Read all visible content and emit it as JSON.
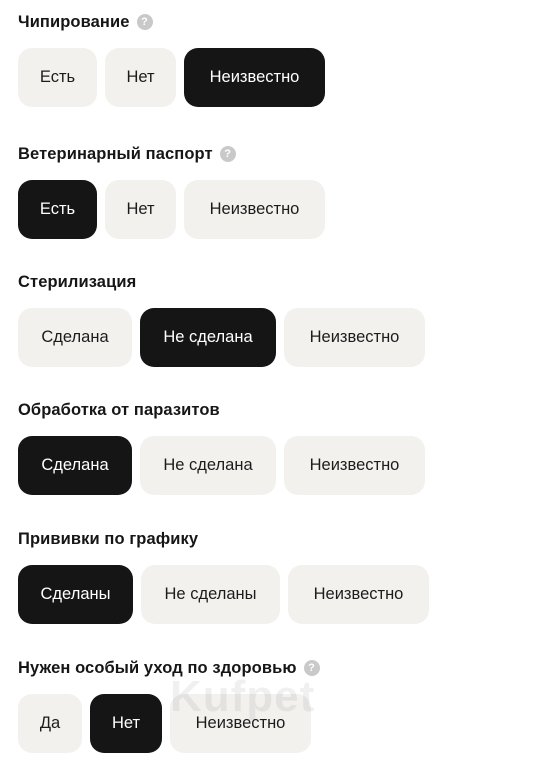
{
  "sections": [
    {
      "title": "Чипирование",
      "has_help": true,
      "help_icon": "question-circle-icon",
      "options": [
        {
          "label": "Есть",
          "selected": false
        },
        {
          "label": "Нет",
          "selected": false
        },
        {
          "label": "Неизвестно",
          "selected": true
        }
      ]
    },
    {
      "title": "Ветеринарный паспорт",
      "has_help": true,
      "help_icon": "question-circle-icon",
      "options": [
        {
          "label": "Есть",
          "selected": true
        },
        {
          "label": "Нет",
          "selected": false
        },
        {
          "label": "Неизвестно",
          "selected": false
        }
      ]
    },
    {
      "title": "Стерилизация",
      "has_help": false,
      "options": [
        {
          "label": "Сделана",
          "selected": false
        },
        {
          "label": "Не сделана",
          "selected": true
        },
        {
          "label": "Неизвестно",
          "selected": false
        }
      ]
    },
    {
      "title": "Обработка от паразитов",
      "has_help": false,
      "options": [
        {
          "label": "Сделана",
          "selected": true
        },
        {
          "label": "Не сделана",
          "selected": false
        },
        {
          "label": "Неизвестно",
          "selected": false
        }
      ]
    },
    {
      "title": "Прививки по графику",
      "has_help": false,
      "options": [
        {
          "label": "Сделаны",
          "selected": true
        },
        {
          "label": "Не сделаны",
          "selected": false
        },
        {
          "label": "Неизвестно",
          "selected": false
        }
      ]
    },
    {
      "title": "Нужен особый уход по здоровью",
      "has_help": true,
      "help_icon": "question-circle-icon",
      "options": [
        {
          "label": "Да",
          "selected": false
        },
        {
          "label": "Нет",
          "selected": true
        },
        {
          "label": "Неизвестно",
          "selected": false
        }
      ]
    }
  ],
  "colors": {
    "selected_bg": "#151515",
    "option_bg": "#f3f1ee",
    "help_icon": "#c9c9c9"
  },
  "watermark": "Kufpet"
}
